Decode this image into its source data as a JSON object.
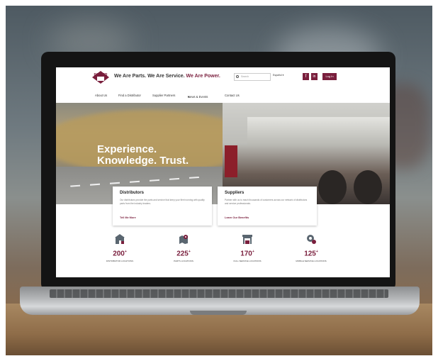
{
  "header": {
    "logo_text": "POWER",
    "tagline_part1": "We Are Parts. We Are Service.",
    "tagline_part2": " We Are Power.",
    "search_placeholder": "Search",
    "language": "Español",
    "facebook_label": "f",
    "linkedin_label": "in",
    "login_label": "Log In"
  },
  "nav": {
    "items": [
      "About Us",
      "Find a Distributor",
      "Supplier Partners",
      "News & Events",
      "Contact Us"
    ]
  },
  "hero": {
    "title_line1": "Experience.",
    "title_line2": "Knowledge. Trust."
  },
  "cards": [
    {
      "title": "Distributors",
      "body": "Our distributors provide the parts and service that keep your fleet running with quality parts from the industry leaders.",
      "link": "Tell Me More"
    },
    {
      "title": "Suppliers",
      "body": "Partner with us to reach thousands of customers across our network of distributors and service professionals.",
      "link": "Learn Our Benefits"
    }
  ],
  "stats": [
    {
      "number": "200",
      "label": "DISTRIBUTOR LOCATIONS"
    },
    {
      "number": "225",
      "label": "PARTS LOCATIONS"
    },
    {
      "number": "170",
      "label": "FULL SERVICE LOCATIONS"
    },
    {
      "number": "125",
      "label": "MOBILE SERVICE LOCATIONS"
    }
  ],
  "colors": {
    "brand": "#7a1f3d"
  }
}
